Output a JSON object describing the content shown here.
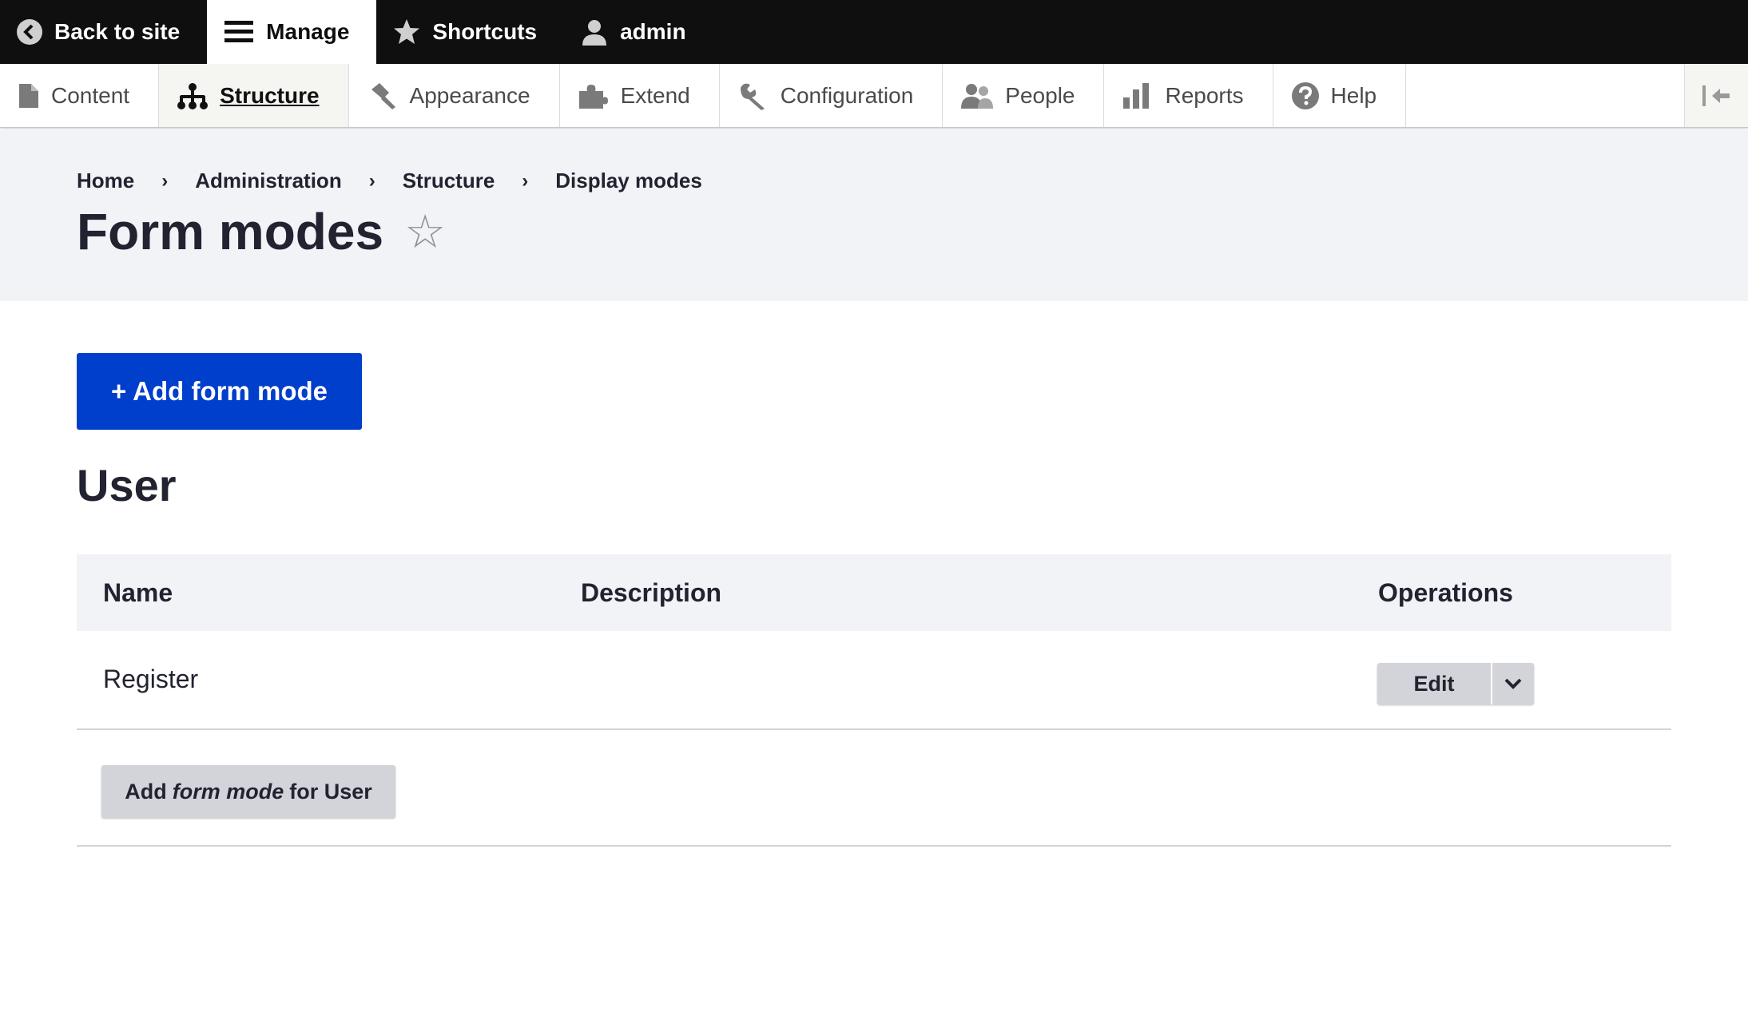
{
  "toolbar": {
    "back_to_site": "Back to site",
    "manage": "Manage",
    "shortcuts": "Shortcuts",
    "user": "admin"
  },
  "tray": {
    "items": [
      {
        "label": "Content",
        "icon": "file-icon"
      },
      {
        "label": "Structure",
        "icon": "sitemap-icon"
      },
      {
        "label": "Appearance",
        "icon": "paintbrush-icon"
      },
      {
        "label": "Extend",
        "icon": "puzzle-icon"
      },
      {
        "label": "Configuration",
        "icon": "wrench-icon"
      },
      {
        "label": "People",
        "icon": "people-icon"
      },
      {
        "label": "Reports",
        "icon": "bar-chart-icon"
      },
      {
        "label": "Help",
        "icon": "help-icon"
      }
    ],
    "active": "Structure"
  },
  "breadcrumb": [
    "Home",
    "Administration",
    "Structure",
    "Display modes"
  ],
  "breadcrumb_separator": "›",
  "page_title": "Form modes",
  "star_glyph": "☆",
  "add_button": "+ Add form mode",
  "section_title": "User",
  "table": {
    "headers": {
      "name": "Name",
      "description": "Description",
      "operations": "Operations"
    },
    "rows": [
      {
        "name": "Register",
        "description": "",
        "operation": "Edit"
      }
    ],
    "footer_button": {
      "prefix": "Add",
      "emphasis": "form mode",
      "suffix": "for User"
    }
  },
  "colors": {
    "primary_button": "#003ecc",
    "toolbar_bg": "#0f0f0f",
    "header_bg": "#f2f3f7"
  }
}
